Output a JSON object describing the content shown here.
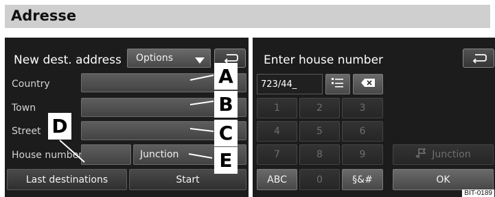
{
  "header": {
    "title": "Adresse"
  },
  "left_screen": {
    "title": "New dest. address",
    "options_label": "Options",
    "fields": {
      "country": "Country",
      "town": "Town",
      "street": "Street",
      "house_number": "House number"
    },
    "junction_label": "Junction",
    "last_destinations_label": "Last destinations",
    "start_label": "Start",
    "callouts": {
      "a": "A",
      "b": "B",
      "c": "C",
      "d": "D",
      "e": "E"
    }
  },
  "right_screen": {
    "title": "Enter house number",
    "input_value": "723/44_",
    "keys": [
      "1",
      "2",
      "3",
      "4",
      "5",
      "6",
      "7",
      "8",
      "9"
    ],
    "junction_label": "Junction",
    "abc_label": "ABC",
    "zero_label": "0",
    "symbols_label": "§&#",
    "ok_label": "OK"
  },
  "image_code": "BIT-0189",
  "icons": [
    "back-arrow-icon",
    "dropdown-triangle-icon",
    "list-icon",
    "backspace-icon",
    "junction-flag-icon"
  ]
}
